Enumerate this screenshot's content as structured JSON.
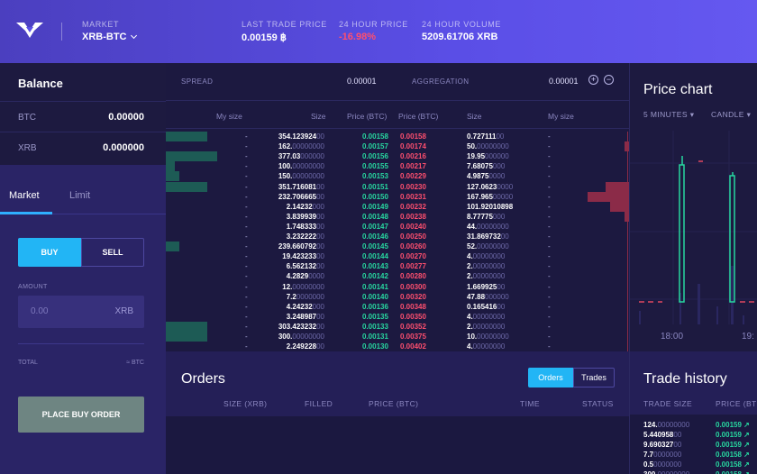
{
  "header": {
    "market_label": "MARKET",
    "market_value": "XRB-BTC",
    "last_trade_label": "LAST TRADE PRICE",
    "last_trade_value": "0.00159 ฿",
    "change_label": "24 HOUR PRICE",
    "change_value": "-16.98%",
    "volume_label": "24 HOUR VOLUME",
    "volume_value": "5209.61706 XRB"
  },
  "balance": {
    "title": "Balance",
    "rows": [
      {
        "asset": "BTC",
        "amount": "0.00000"
      },
      {
        "asset": "XRB",
        "amount": "0.000000"
      }
    ]
  },
  "order_form": {
    "tabs": [
      "Market",
      "Limit"
    ],
    "active_tab": "Market",
    "buy_label": "BUY",
    "sell_label": "SELL",
    "amount_label": "AMOUNT",
    "amount_placeholder": "0.00",
    "amount_currency": "XRB",
    "total_label": "TOTAL",
    "total_value": "≈ BTC",
    "submit_label": "PLACE BUY ORDER"
  },
  "order_book": {
    "spread_label": "SPREAD",
    "spread_value": "0.00001",
    "aggregation_label": "AGGREGATION",
    "aggregation_value": "0.00001",
    "columns": [
      "My size",
      "Size",
      "Price (BTC)",
      "Price (BTC)",
      "Size",
      "My size"
    ],
    "rows": [
      {
        "my_bid": "-",
        "bid_size": [
          "354.123924",
          "00"
        ],
        "bid_price": "0.00158",
        "ask_price": "0.00158",
        "ask_size": [
          "0.727111",
          "00"
        ],
        "my_ask": "-",
        "bid_depth": 0.09,
        "ask_depth": 0
      },
      {
        "my_bid": "-",
        "bid_size": [
          "162.",
          "00000000"
        ],
        "bid_price": "0.00157",
        "ask_price": "0.00174",
        "ask_size": [
          "50.",
          "00000000"
        ],
        "my_ask": "-",
        "bid_depth": 0,
        "ask_depth": 0.01
      },
      {
        "my_bid": "-",
        "bid_size": [
          "377.03",
          "000000"
        ],
        "bid_price": "0.00156",
        "ask_price": "0.00216",
        "ask_size": [
          "19.95",
          "000000"
        ],
        "my_ask": "-",
        "bid_depth": 0.11,
        "ask_depth": 0
      },
      {
        "my_bid": "-",
        "bid_size": [
          "100.",
          "00000000"
        ],
        "bid_price": "0.00155",
        "ask_price": "0.00217",
        "ask_size": [
          "7.68075",
          "000"
        ],
        "my_ask": "-",
        "bid_depth": 0.02,
        "ask_depth": 0
      },
      {
        "my_bid": "-",
        "bid_size": [
          "150.",
          "00000000"
        ],
        "bid_price": "0.00153",
        "ask_price": "0.00229",
        "ask_size": [
          "4.9875",
          "0000"
        ],
        "my_ask": "-",
        "bid_depth": 0.03,
        "ask_depth": 0
      },
      {
        "my_bid": "-",
        "bid_size": [
          "351.716081",
          "00"
        ],
        "bid_price": "0.00151",
        "ask_price": "0.00230",
        "ask_size": [
          "127.0623",
          "0000"
        ],
        "my_ask": "-",
        "bid_depth": 0.09,
        "ask_depth": 0.05
      },
      {
        "my_bid": "-",
        "bid_size": [
          "232.706665",
          "00"
        ],
        "bid_price": "0.00150",
        "ask_price": "0.00231",
        "ask_size": [
          "167.965",
          "00000"
        ],
        "my_ask": "-",
        "bid_depth": 0,
        "ask_depth": 0.09
      },
      {
        "my_bid": "-",
        "bid_size": [
          "2.14232",
          "000"
        ],
        "bid_price": "0.00149",
        "ask_price": "0.00232",
        "ask_size": [
          "101.92010898",
          ""
        ],
        "my_ask": "-",
        "bid_depth": 0,
        "ask_depth": 0.04
      },
      {
        "my_bid": "-",
        "bid_size": [
          "3.839939",
          "00"
        ],
        "bid_price": "0.00148",
        "ask_price": "0.00238",
        "ask_size": [
          "8.77775",
          "000"
        ],
        "my_ask": "-",
        "bid_depth": 0,
        "ask_depth": 0.01
      },
      {
        "my_bid": "-",
        "bid_size": [
          "1.748333",
          "00"
        ],
        "bid_price": "0.00147",
        "ask_price": "0.00240",
        "ask_size": [
          "44.",
          "00000000"
        ],
        "my_ask": "-",
        "bid_depth": 0,
        "ask_depth": 0
      },
      {
        "my_bid": "-",
        "bid_size": [
          "3.232222",
          "00"
        ],
        "bid_price": "0.00146",
        "ask_price": "0.00250",
        "ask_size": [
          "31.869732",
          "00"
        ],
        "my_ask": "-",
        "bid_depth": 0,
        "ask_depth": 0
      },
      {
        "my_bid": "-",
        "bid_size": [
          "239.660792",
          "00"
        ],
        "bid_price": "0.00145",
        "ask_price": "0.00260",
        "ask_size": [
          "52.",
          "00000000"
        ],
        "my_ask": "-",
        "bid_depth": 0.03,
        "ask_depth": 0
      },
      {
        "my_bid": "-",
        "bid_size": [
          "19.423233",
          "00"
        ],
        "bid_price": "0.00144",
        "ask_price": "0.00270",
        "ask_size": [
          "4.",
          "00000000"
        ],
        "my_ask": "-",
        "bid_depth": 0,
        "ask_depth": 0
      },
      {
        "my_bid": "-",
        "bid_size": [
          "6.562132",
          "00"
        ],
        "bid_price": "0.00143",
        "ask_price": "0.00277",
        "ask_size": [
          "2.",
          "00000000"
        ],
        "my_ask": "-",
        "bid_depth": 0,
        "ask_depth": 0
      },
      {
        "my_bid": "-",
        "bid_size": [
          "4.2829",
          "0000"
        ],
        "bid_price": "0.00142",
        "ask_price": "0.00280",
        "ask_size": [
          "2.",
          "00000000"
        ],
        "my_ask": "-",
        "bid_depth": 0,
        "ask_depth": 0
      },
      {
        "my_bid": "-",
        "bid_size": [
          "12.",
          "00000000"
        ],
        "bid_price": "0.00141",
        "ask_price": "0.00300",
        "ask_size": [
          "1.669925",
          "00"
        ],
        "my_ask": "-",
        "bid_depth": 0,
        "ask_depth": 0
      },
      {
        "my_bid": "-",
        "bid_size": [
          "7.2",
          "0000000"
        ],
        "bid_price": "0.00140",
        "ask_price": "0.00320",
        "ask_size": [
          "47.88",
          "000000"
        ],
        "my_ask": "-",
        "bid_depth": 0,
        "ask_depth": 0
      },
      {
        "my_bid": "-",
        "bid_size": [
          "4.24232",
          "000"
        ],
        "bid_price": "0.00136",
        "ask_price": "0.00348",
        "ask_size": [
          "0.165416",
          "00"
        ],
        "my_ask": "-",
        "bid_depth": 0,
        "ask_depth": 0
      },
      {
        "my_bid": "-",
        "bid_size": [
          "3.248987",
          "00"
        ],
        "bid_price": "0.00135",
        "ask_price": "0.00350",
        "ask_size": [
          "4.",
          "00000000"
        ],
        "my_ask": "-",
        "bid_depth": 0,
        "ask_depth": 0
      },
      {
        "my_bid": "-",
        "bid_size": [
          "303.423232",
          "00"
        ],
        "bid_price": "0.00133",
        "ask_price": "0.00352",
        "ask_size": [
          "2.",
          "00000000"
        ],
        "my_ask": "-",
        "bid_depth": 0.09,
        "ask_depth": 0
      },
      {
        "my_bid": "-",
        "bid_size": [
          "300.",
          "00000000"
        ],
        "bid_price": "0.00131",
        "ask_price": "0.00375",
        "ask_size": [
          "10.",
          "00000000"
        ],
        "my_ask": "-",
        "bid_depth": 0.09,
        "ask_depth": 0
      },
      {
        "my_bid": "-",
        "bid_size": [
          "2.249228",
          "00"
        ],
        "bid_price": "0.00130",
        "ask_price": "0.00402",
        "ask_size": [
          "4.",
          "00000000"
        ],
        "my_ask": "-",
        "bid_depth": 0,
        "ask_depth": 0
      }
    ]
  },
  "price_chart": {
    "title": "Price chart",
    "interval": "5 MINUTES",
    "style": "CANDLE",
    "time_labels": [
      "18:00",
      "19:"
    ]
  },
  "orders": {
    "title": "Orders",
    "toggle": [
      "Orders",
      "Trades"
    ],
    "active_toggle": "Orders",
    "columns": [
      "SIZE (XRB)",
      "FILLED",
      "PRICE (BTC)",
      "TIME",
      "STATUS"
    ]
  },
  "trade_history": {
    "title": "Trade history",
    "columns": [
      "TRADE SIZE",
      "PRICE (BT"
    ],
    "rows": [
      {
        "size": [
          "124.",
          "00000000"
        ],
        "price": "0.00159"
      },
      {
        "size": [
          "5.440958",
          "00"
        ],
        "price": "0.00159"
      },
      {
        "size": [
          "9.690327",
          "00"
        ],
        "price": "0.00159"
      },
      {
        "size": [
          "7.7",
          "0000000"
        ],
        "price": "0.00158"
      },
      {
        "size": [
          "0.5",
          "0000000"
        ],
        "price": "0.00158"
      },
      {
        "size": [
          "300.",
          "00000000"
        ],
        "price": "0.00158"
      }
    ]
  },
  "colors": {
    "accent": "#22b5f5",
    "bid": "#27d8a0",
    "ask": "#ff4f6e",
    "header": "#5a4ee6"
  }
}
